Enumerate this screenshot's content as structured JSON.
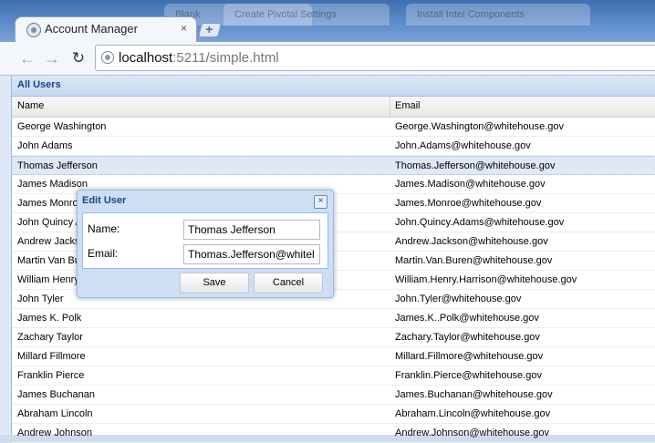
{
  "browser": {
    "tab_title": "Account Manager",
    "tab_close": "×",
    "new_tab": "+",
    "bg_tabs": [
      "Blank",
      "Create Pivotal Settings",
      "Install Intel Components"
    ],
    "back": "←",
    "forward": "→",
    "reload": "↻",
    "url_host": "localhost",
    "url_path": ":5211/simple.html"
  },
  "panel": {
    "title": "All Users",
    "columns": [
      "Name",
      "Email"
    ]
  },
  "users": [
    {
      "name": "George Washington",
      "email": "George.Washington@whitehouse.gov"
    },
    {
      "name": "John Adams",
      "email": "John.Adams@whitehouse.gov"
    },
    {
      "name": "Thomas Jefferson",
      "email": "Thomas.Jefferson@whitehouse.gov",
      "selected": true
    },
    {
      "name": "James Madison",
      "email": "James.Madison@whitehouse.gov"
    },
    {
      "name": "James Monroe",
      "email": "James.Monroe@whitehouse.gov"
    },
    {
      "name": "John Quincy Adams",
      "email": "John.Quincy.Adams@whitehouse.gov"
    },
    {
      "name": "Andrew Jackson",
      "email": "Andrew.Jackson@whitehouse.gov"
    },
    {
      "name": "Martin Van Buren",
      "email": "Martin.Van.Buren@whitehouse.gov"
    },
    {
      "name": "William Henry Harrison",
      "email": "William.Henry.Harrison@whitehouse.gov"
    },
    {
      "name": "John Tyler",
      "email": "John.Tyler@whitehouse.gov"
    },
    {
      "name": "James K. Polk",
      "email": "James.K..Polk@whitehouse.gov"
    },
    {
      "name": "Zachary Taylor",
      "email": "Zachary.Taylor@whitehouse.gov"
    },
    {
      "name": "Millard Fillmore",
      "email": "Millard.Fillmore@whitehouse.gov"
    },
    {
      "name": "Franklin Pierce",
      "email": "Franklin.Pierce@whitehouse.gov"
    },
    {
      "name": "James Buchanan",
      "email": "James.Buchanan@whitehouse.gov"
    },
    {
      "name": "Abraham Lincoln",
      "email": "Abraham.Lincoln@whitehouse.gov"
    },
    {
      "name": "Andrew Johnson",
      "email": "Andrew.Johnson@whitehouse.gov"
    }
  ],
  "edit_window": {
    "title": "Edit User",
    "close": "×",
    "name_label": "Name:",
    "email_label": "Email:",
    "name_value": "Thomas Jefferson",
    "email_value": "Thomas.Jefferson@whitel",
    "save_label": "Save",
    "cancel_label": "Cancel"
  }
}
